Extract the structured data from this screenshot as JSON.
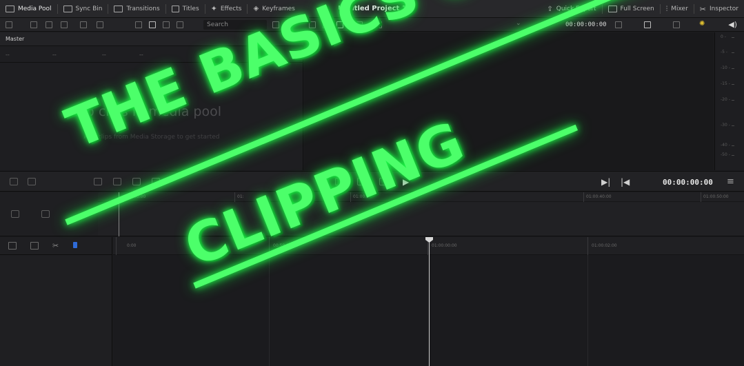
{
  "topbar": {
    "left_items": [
      {
        "label": "Media Pool",
        "icon": "media-pool-icon",
        "active": true
      },
      {
        "label": "Sync Bin",
        "icon": "sync-bin-icon"
      },
      {
        "label": "Transitions",
        "icon": "transitions-icon"
      },
      {
        "label": "Titles",
        "icon": "titles-icon"
      },
      {
        "label": "Effects",
        "icon": "effects-wand-icon"
      },
      {
        "label": "Keyframes",
        "icon": "keyframes-icon"
      }
    ],
    "project_title": "Untitled Project 1",
    "right_items": [
      {
        "label": "Quick Export",
        "icon": "export-icon"
      },
      {
        "label": "Full Screen",
        "icon": "fullscreen-icon"
      },
      {
        "label": "Mixer",
        "icon": "mixer-icon"
      },
      {
        "label": "Inspector",
        "icon": "inspector-icon"
      }
    ]
  },
  "toolbar2": {
    "search_placeholder": "Search",
    "viewer_timecode": "00:00:00:00"
  },
  "media_pool": {
    "bin_name": "Master",
    "bin_columns": [
      "--",
      "--",
      "--",
      "--"
    ],
    "empty_title": "No clips in media pool",
    "empty_subtitle": "Add clips from Media Storage to get started"
  },
  "audio_meter": {
    "marks": [
      "0 -",
      "-5 -",
      "-10 -",
      "-15 -",
      "-20 -",
      "-30 -",
      "-40 -",
      "-50 -"
    ]
  },
  "transport": {
    "timecode": "00:00:00:00"
  },
  "timeline_upper": {
    "ruler_labels": [
      "00:00",
      "01:",
      "01:00:20",
      "01:00:40:00",
      "01:00:50:00"
    ]
  },
  "timeline_lower": {
    "ruler_labels": [
      "0:00",
      "00:59:58:00",
      "01:00:00:00",
      "01:00:02:00"
    ]
  },
  "overlay": {
    "line1": "THE BASICS OF",
    "line2": "CLIPPING",
    "color": "#4cff6a"
  }
}
